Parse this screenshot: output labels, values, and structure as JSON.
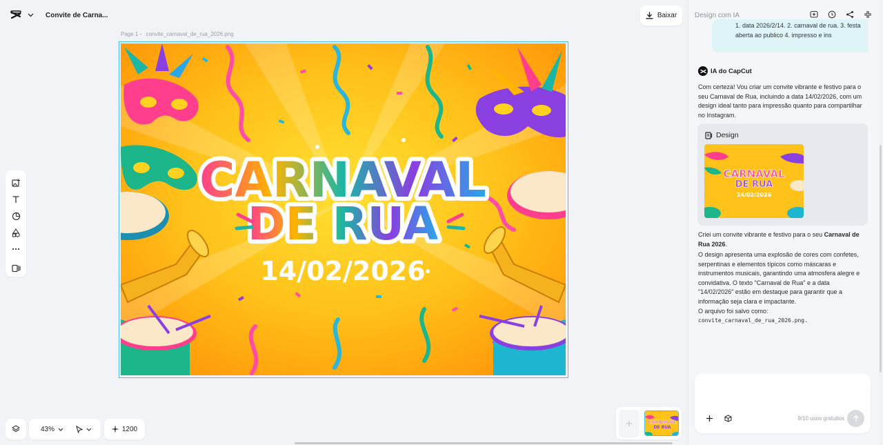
{
  "project": {
    "title": "Convite de Carna..."
  },
  "toolbar": {
    "download_label": "Baixar"
  },
  "canvas": {
    "page_label": "Page 1 -",
    "file_name": "convite_carnaval_de_rua_2026.png",
    "artwork": {
      "title_line1": "CARNAVAL",
      "title_line2": "DE RUA",
      "date": "14/02/2026",
      "colors": {
        "bg_inner": "#ffd21f",
        "bg_outer": "#ff9f0d",
        "border": "#3fc6e4"
      }
    }
  },
  "bottom": {
    "zoom": "43%",
    "size": "1200"
  },
  "panel": {
    "header": "Design com IA",
    "user_message_lines": [
      "1. data 2026/2/14. 2. carnaval de rua. 3. festa",
      "aberta ao publico 4. impresso e ins"
    ],
    "assistant_name": "IA do CapCut",
    "intro": "Com certeza! Vou criar um convite vibrante e festivo para o seu Carnaval de Rua, incluindo a data 14/02/2026, com um design ideal tanto para impressão quanto para compartilhar no Instagram.",
    "design_card": {
      "label": "Design"
    },
    "result_prefix": "Criei um convite vibrante e festivo para o seu ",
    "result_bold": "Carnaval de Rua 2026",
    "result_suffix": ".",
    "description": "O design apresenta uma explosão de cores com confetes, serpentinas e elementos típicos como máscaras e instrumentos musicais, garantindo uma atmosfera alegre e convidativa. O texto \"Carnaval de Rua\" e a data \"14/02/2026\" estão em destaque para garantir que a informação seja clara e impactante.",
    "saved_as_label": "O arquivo foi salvo como:",
    "saved_file": "convite_carnaval_de_rua_2026.png.",
    "usage": "9/10 usos gratuitos"
  }
}
